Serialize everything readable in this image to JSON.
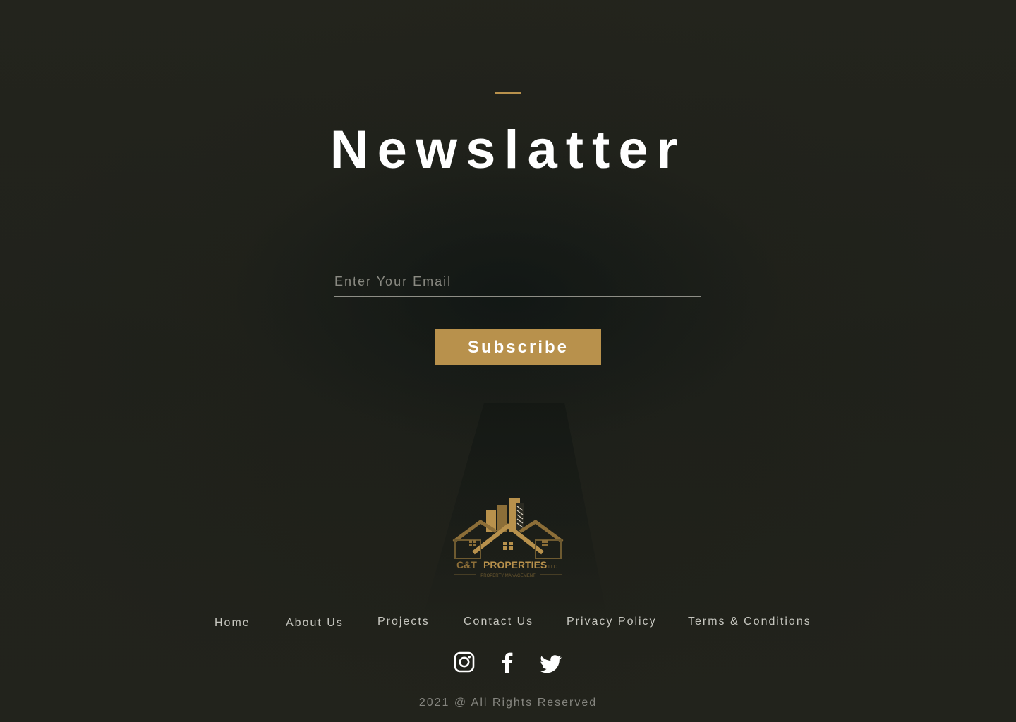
{
  "newsletter": {
    "title": "Newslatter",
    "email_placeholder": "Enter Your Email",
    "email_value": "",
    "subscribe_label": "Subscribe"
  },
  "brand": {
    "name_part1": "C&T",
    "name_part2": "PROPERTIES",
    "suffix": "LLC",
    "tagline": "PROPERTY MANAGEMENT"
  },
  "footer": {
    "nav": [
      {
        "label": "Home"
      },
      {
        "label": "About Us"
      },
      {
        "label": "Projects"
      },
      {
        "label": "Contact Us"
      },
      {
        "label": "Privacy Policy"
      },
      {
        "label": "Terms & Conditions"
      }
    ],
    "social": [
      {
        "icon": "instagram-icon"
      },
      {
        "icon": "facebook-icon"
      },
      {
        "icon": "twitter-icon"
      }
    ],
    "copyright": "2021 @ All Rights Reserved"
  },
  "colors": {
    "accent": "#b8914c",
    "background": "#22231c",
    "text_primary": "#ffffff",
    "text_muted": "#c6c6bf"
  }
}
